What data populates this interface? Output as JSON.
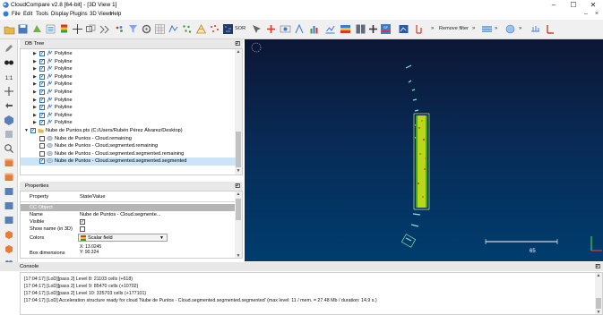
{
  "window": {
    "title": "CloudCompare v2.8 [64-bit] - [3D View 1]",
    "minimize": "–",
    "maximize": "☐",
    "close": "✕"
  },
  "menu": [
    "File",
    "Edit",
    "Tools",
    "Display",
    "Plugins",
    "3D Views",
    "Help"
  ],
  "toolbar": {
    "sor_label": "SOR",
    "remove_filter_label": "Remove filter",
    "more_1": "»",
    "more_2": "»",
    "more_3": "»",
    "more_4": "»"
  },
  "db_tree": {
    "title": "DB Tree",
    "float_icon": "◰",
    "items": [
      {
        "label": "Polyline",
        "checked": true,
        "level": 1
      },
      {
        "label": "Polyline",
        "checked": true,
        "level": 1
      },
      {
        "label": "Polyline",
        "checked": true,
        "level": 1
      },
      {
        "label": "Polyline",
        "checked": true,
        "level": 1
      },
      {
        "label": "Polyline",
        "checked": true,
        "level": 1
      },
      {
        "label": "Polyline",
        "checked": true,
        "level": 1
      },
      {
        "label": "Polyline",
        "checked": true,
        "level": 1
      },
      {
        "label": "Polyline",
        "checked": true,
        "level": 1
      },
      {
        "label": "Polyline",
        "checked": true,
        "level": 1
      },
      {
        "label": "Polyline",
        "checked": true,
        "level": 1
      },
      {
        "label": "Nube de Puntos.pts (C:/Users/Rubén Pérez Álvarez/Desktop)",
        "checked": true,
        "level": 0
      },
      {
        "label": "Nube de Puntos - Cloud.remaining",
        "checked": false,
        "level": 1
      },
      {
        "label": "Nube de Puntos - Cloud.segmented.remaining",
        "checked": false,
        "level": 1
      },
      {
        "label": "Nube de Puntos - Cloud.segmented.segmented.remaining",
        "checked": false,
        "level": 1
      },
      {
        "label": "Nube de Puntos - Cloud.segmented.segmented.segmented",
        "checked": true,
        "level": 1,
        "selected": true
      }
    ]
  },
  "properties": {
    "title": "Properties",
    "float_icon": "◰",
    "col_property": "Property",
    "col_state": "State/Value",
    "section": "CC Object",
    "name_key": "Name",
    "name_value": "Nube de Puntos - Cloud.segmente...",
    "visible_key": "Visible",
    "show_name_key": "Show name (in 3D)",
    "colors_key": "Colors",
    "colors_value": "Scalar field",
    "box_key": "Box dimensions",
    "box_x": "X: 13.0245",
    "box_y": "Y: 90.324"
  },
  "viewport": {
    "scale_label": "65"
  },
  "console": {
    "title": "Console",
    "float_icon": "◰",
    "lines": [
      "[17:04:17] [LoD][pass 2] Level 8: 21103 cells (+618)",
      "[17:04:17] [LoD][pass 2] Level 9: 85470 cells (+10702)",
      "[17:04:17] [LoD][pass 2] Level 10: 335703 cells (+177101)",
      "[17:04:17] [LoD] Acceleration structure ready for cloud 'Nube de Puntos - Cloud.segmented.segmented.segmented' (max level: 11 / mem. = 27.48 Mb / duration: 14.9 s.)"
    ]
  },
  "colors": {
    "accent": "#0078d7",
    "selection": "#cce4f7",
    "viewport_top": "#0c1634",
    "viewport_bottom": "#003d6e",
    "section_bg": "#b5b5b5"
  }
}
